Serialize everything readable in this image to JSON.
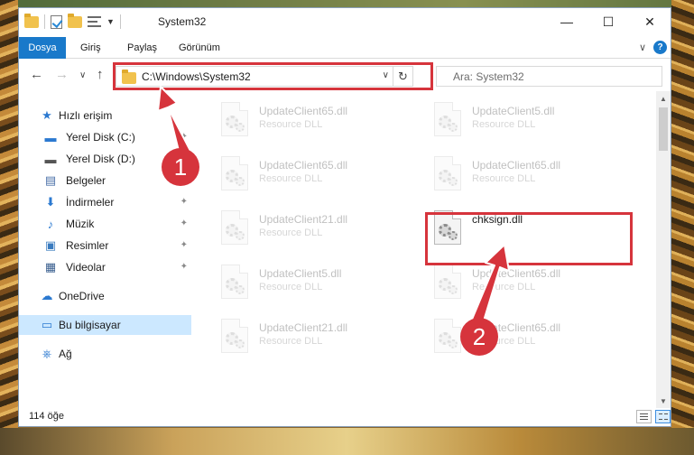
{
  "window": {
    "title": "System32",
    "controls": {
      "minimize": "—",
      "maximize": "☐",
      "close": "✕"
    }
  },
  "ribbon": {
    "tabs": [
      "Dosya",
      "Giriş",
      "Paylaş",
      "Görünüm"
    ],
    "collapse_glyph": "∨",
    "help_glyph": "?"
  },
  "navigation": {
    "back_glyph": "←",
    "forward_glyph": "→",
    "recent_glyph": "∨",
    "up_glyph": "↑",
    "address": "C:\\Windows\\System32",
    "address_dropdown_glyph": "∨",
    "refresh_glyph": "↻",
    "search_placeholder": "Ara: System32"
  },
  "sidebar": {
    "items": [
      {
        "label": "Hızlı erişim",
        "icon": "★",
        "icon_color": "#2b79d0",
        "level": 0,
        "pinned": false
      },
      {
        "label": "Yerel Disk (C:)",
        "icon": "▬",
        "icon_color": "#2b79d0",
        "level": 1,
        "pinned": true
      },
      {
        "label": "Yerel Disk (D:)",
        "icon": "▬",
        "icon_color": "#555555",
        "level": 1,
        "pinned": true
      },
      {
        "label": "Belgeler",
        "icon": "▤",
        "icon_color": "#4a6fa8",
        "level": 1,
        "pinned": true
      },
      {
        "label": "İndirmeler",
        "icon": "⬇",
        "icon_color": "#2b79d0",
        "level": 1,
        "pinned": true
      },
      {
        "label": "Müzik",
        "icon": "♪",
        "icon_color": "#2b79d0",
        "level": 1,
        "pinned": true
      },
      {
        "label": "Resimler",
        "icon": "▣",
        "icon_color": "#3a7bbf",
        "level": 1,
        "pinned": true
      },
      {
        "label": "Videolar",
        "icon": "▦",
        "icon_color": "#3a5f8f",
        "level": 1,
        "pinned": true
      },
      {
        "label": "OneDrive",
        "icon": "☁",
        "icon_color": "#2b79d0",
        "level": 0,
        "pinned": false
      },
      {
        "label": "Bu bilgisayar",
        "icon": "▭",
        "icon_color": "#2b79d0",
        "level": 0,
        "pinned": false,
        "selected": true
      },
      {
        "label": "Ağ",
        "icon": "⎈",
        "icon_color": "#2b79d0",
        "level": 0,
        "pinned": false
      }
    ],
    "pin_glyph": "✦"
  },
  "files": [
    {
      "name": "UpdateClient65.dll",
      "type": "Resource DLL",
      "faded": true
    },
    {
      "name": "UpdateClient5.dll",
      "type": "Resource DLL",
      "faded": true
    },
    {
      "name": "UpdateClient65.dll",
      "type": "Resource DLL",
      "faded": true
    },
    {
      "name": "UpdateClient65.dll",
      "type": "Resource DLL",
      "faded": true
    },
    {
      "name": "UpdateClient21.dll",
      "type": "Resource DLL",
      "faded": true
    },
    {
      "name": "chksign.dll",
      "type": "",
      "faded": false
    },
    {
      "name": "UpdateClient5.dll",
      "type": "Resource DLL",
      "faded": true
    },
    {
      "name": "UpdateClient65.dll",
      "type": "Resource DLL",
      "faded": true
    },
    {
      "name": "UpdateClient21.dll",
      "type": "Resource DLL",
      "faded": true
    },
    {
      "name": "UpdateClient65.dll",
      "type": "Resource DLL",
      "faded": true
    }
  ],
  "status": {
    "item_count": "114 öğe"
  },
  "annotations": {
    "step1": "1",
    "step2": "2",
    "color": "#d6343c"
  },
  "colors": {
    "accent": "#1979ca",
    "selection": "#cce8ff",
    "highlight": "#d6343c"
  }
}
